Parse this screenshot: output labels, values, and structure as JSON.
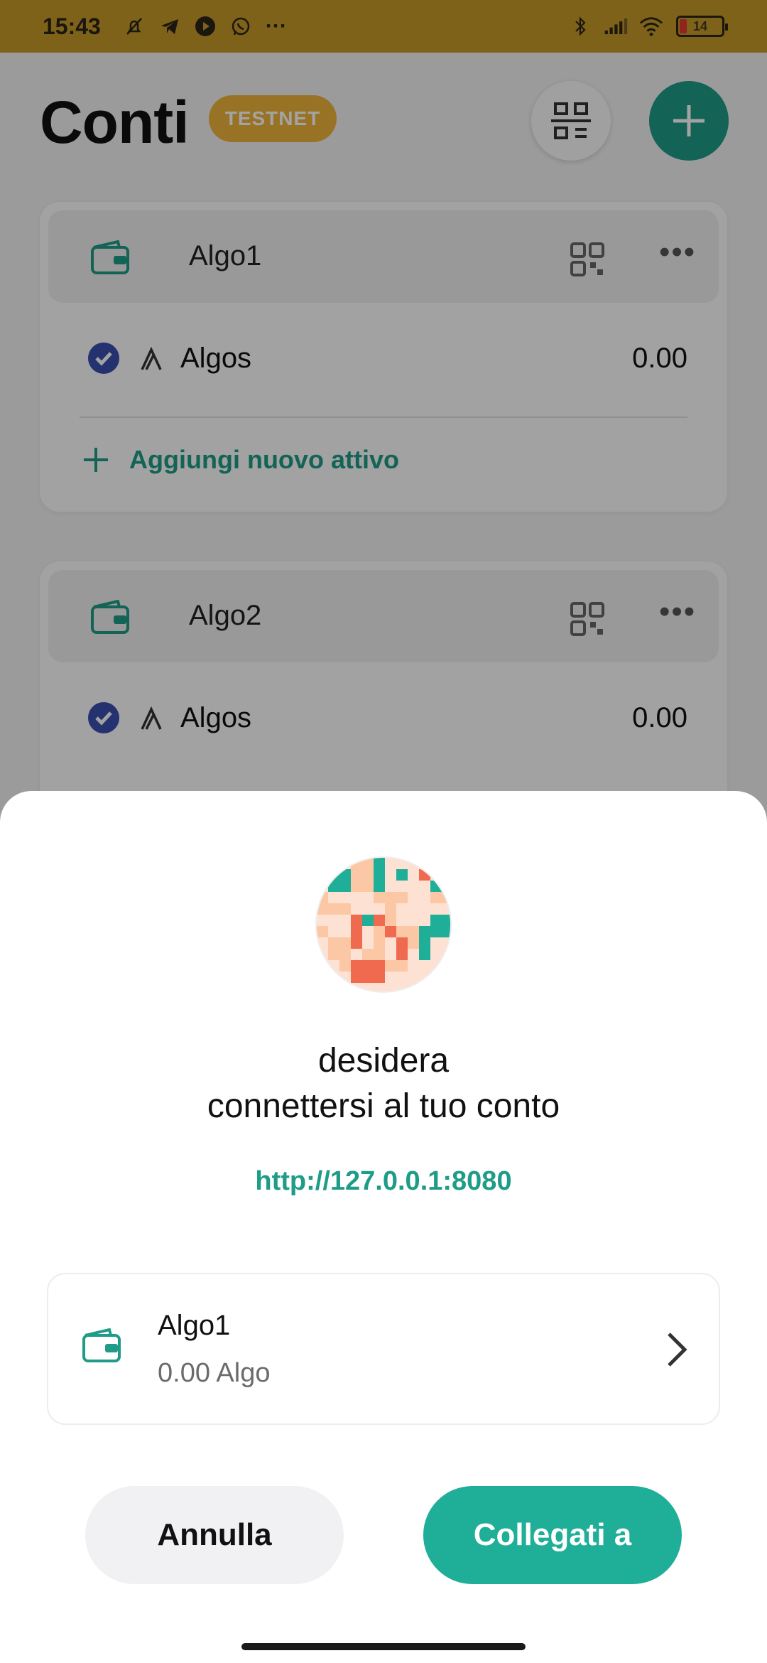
{
  "status_bar": {
    "time": "15:43",
    "battery": "14",
    "icons": [
      "mute-bell-icon",
      "telegram-icon",
      "youtube-icon",
      "whatsapp-icon",
      "more-dots-icon",
      "bluetooth-icon",
      "signal-icon",
      "wifi-icon",
      "battery-icon"
    ]
  },
  "header": {
    "title": "Conti",
    "network_badge": "TESTNET"
  },
  "accounts": [
    {
      "name": "Algo1",
      "asset": {
        "name": "Algos",
        "amount": "0.00"
      },
      "add_asset_label": "Aggiungi nuovo attivo"
    },
    {
      "name": "Algo2",
      "asset": {
        "name": "Algos",
        "amount": "0.00"
      }
    }
  ],
  "connect_sheet": {
    "line1": "desidera",
    "line2": "connettersi al tuo conto",
    "url": "http://127.0.0.1:8080",
    "selected_account": {
      "name": "Algo1",
      "balance": "0.00 Algo"
    },
    "cancel_label": "Annulla",
    "connect_label": "Collegati a"
  },
  "colors": {
    "accent": "#1f9c87",
    "connect_button": "#1fae97",
    "badge": "#f0b43a",
    "status_bar": "#c69a2a",
    "verified": "#3a4fb0"
  }
}
